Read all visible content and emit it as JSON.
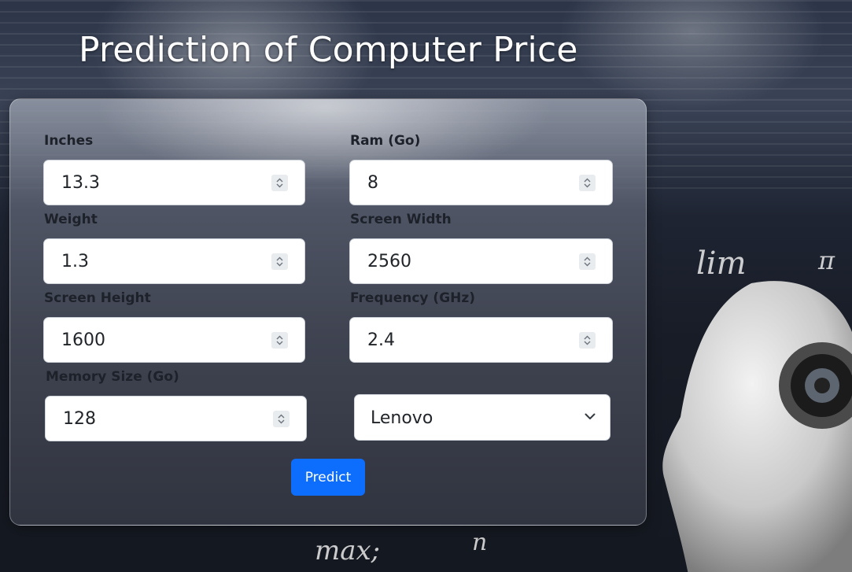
{
  "page": {
    "title": "Prediction of Computer Price"
  },
  "form": {
    "fields": [
      {
        "label": "Inches",
        "value": "13.3"
      },
      {
        "label": "Ram (Go)",
        "value": "8"
      },
      {
        "label": "Weight",
        "value": "1.3"
      },
      {
        "label": "Screen Width",
        "value": "2560"
      },
      {
        "label": "Screen Height",
        "value": "1600"
      },
      {
        "label": "Frequency (GHz)",
        "value": "2.4"
      },
      {
        "label": "Memory Size (Go)",
        "value": "128"
      }
    ],
    "brand_select": {
      "value": "Lenovo",
      "icon": "chevron-down-icon"
    },
    "predict_label": "Predict"
  },
  "colors": {
    "button": "#0d6efd"
  }
}
